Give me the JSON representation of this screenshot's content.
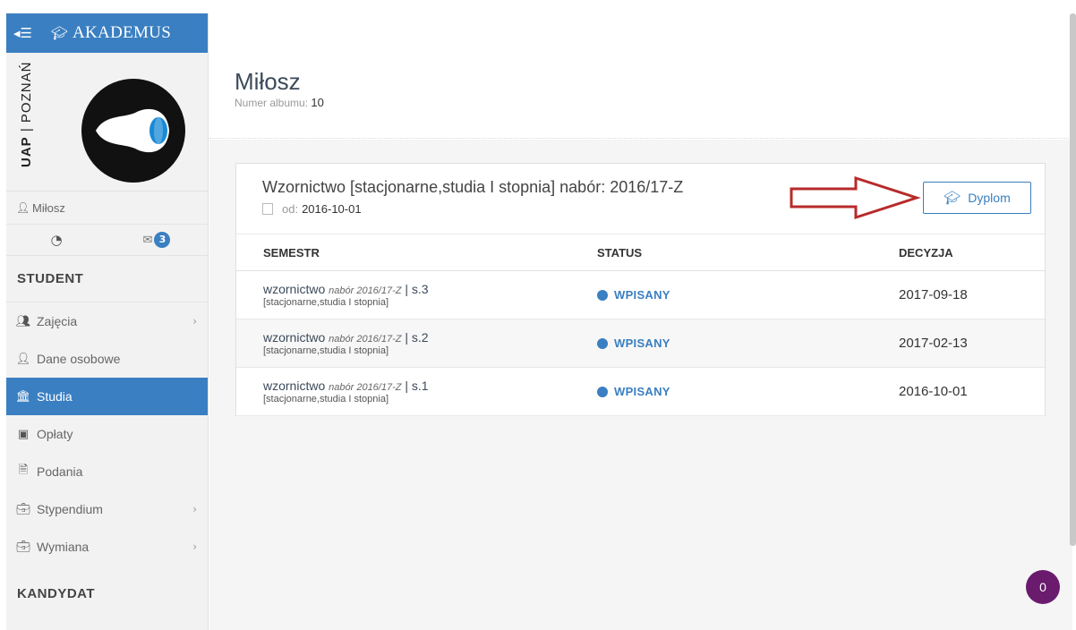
{
  "app": {
    "brand": "AKADEMUS",
    "toggle_icon": "collapse-menu-icon",
    "logo_icon": "graduation-cap-icon"
  },
  "university": {
    "abbr": "UAP",
    "name": "POZNAŃ"
  },
  "user": {
    "name": "Miłosz",
    "messages_count": "3"
  },
  "sidebar": {
    "section_student": "STUDENT",
    "items": [
      {
        "label": "Zajęcia",
        "icon": "people-icon",
        "has_submenu": true
      },
      {
        "label": "Dane osobowe",
        "icon": "user-icon",
        "has_submenu": false
      },
      {
        "label": "Studia",
        "icon": "bank-icon",
        "has_submenu": false,
        "active": true
      },
      {
        "label": "Opłaty",
        "icon": "money-icon",
        "has_submenu": false
      },
      {
        "label": "Podania",
        "icon": "document-icon",
        "has_submenu": false
      },
      {
        "label": "Stypendium",
        "icon": "briefcase-icon",
        "has_submenu": true
      },
      {
        "label": "Wymiana",
        "icon": "briefcase-icon",
        "has_submenu": true
      }
    ],
    "section_kandydat": "KANDYDAT"
  },
  "header": {
    "student_name": "Miłosz",
    "album_label": "Numer albumu:",
    "album_number": "10"
  },
  "program": {
    "title": "Wzornictwo [stacjonarne,studia I stopnia] nabór: 2016/17-Z",
    "date_label": "od:",
    "date_value": "2016-10-01",
    "diploma_button": "Dyplom"
  },
  "table": {
    "headers": [
      "SEMESTR",
      "STATUS",
      "DECYZJA"
    ],
    "rows": [
      {
        "program": "wzornictwo",
        "intake": "nabór 2016/17-Z",
        "semester": "| s.3",
        "mode": "[stacjonarne,studia I stopnia]",
        "status": "WPISANY",
        "decision": "2017-09-18"
      },
      {
        "program": "wzornictwo",
        "intake": "nabór 2016/17-Z",
        "semester": "| s.2",
        "mode": "[stacjonarne,studia I stopnia]",
        "status": "WPISANY",
        "decision": "2017-02-13"
      },
      {
        "program": "wzornictwo",
        "intake": "nabór 2016/17-Z",
        "semester": "| s.1",
        "mode": "[stacjonarne,studia I stopnia]",
        "status": "WPISANY",
        "decision": "2016-10-01"
      }
    ]
  },
  "fab": {
    "count": "0"
  },
  "colors": {
    "accent": "#3a7fc1",
    "annotation_arrow": "#b82a2a",
    "fab": "#6a1b6e"
  }
}
